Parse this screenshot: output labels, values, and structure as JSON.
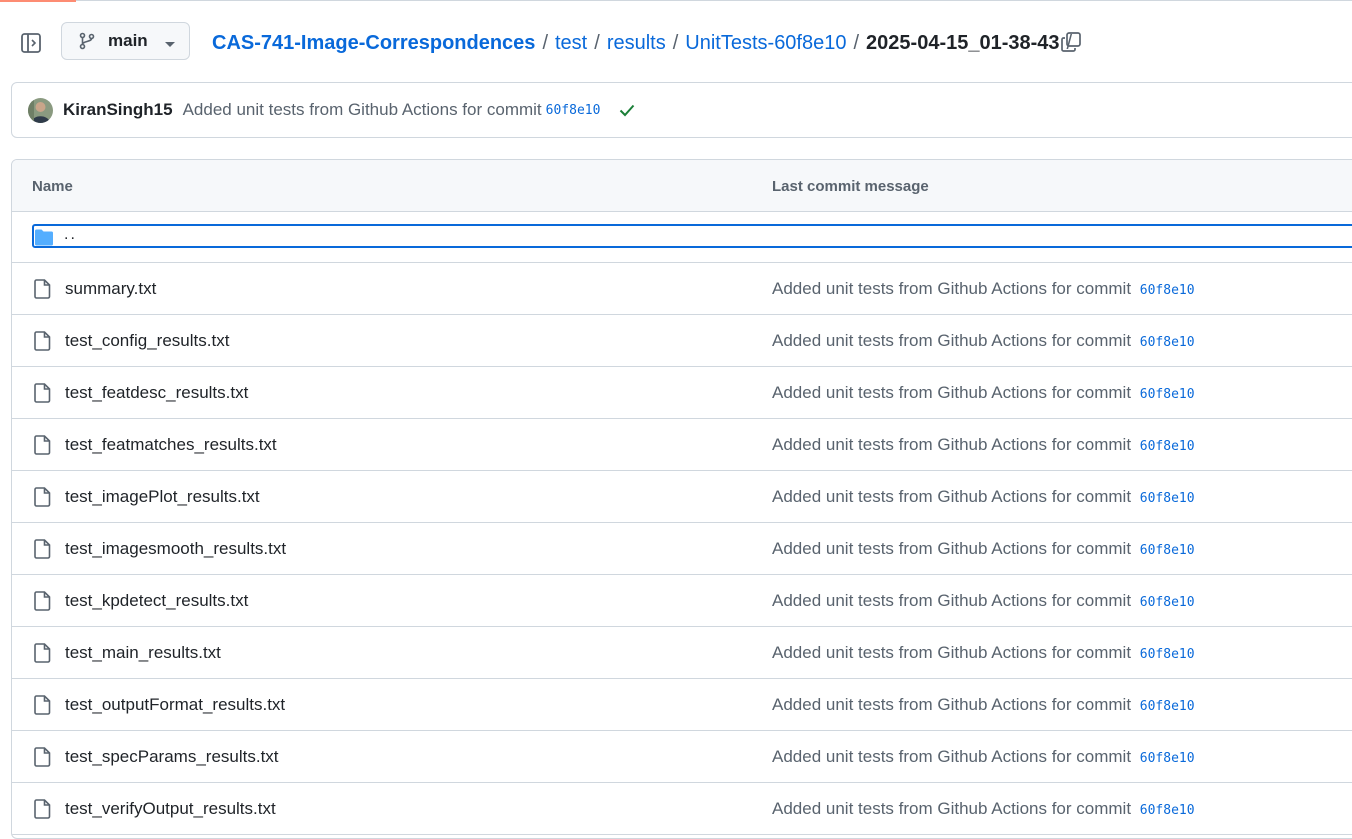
{
  "header": {
    "branch": "main",
    "breadcrumb": [
      {
        "label": "CAS-741-Image-Correspondences",
        "link": true
      },
      {
        "label": "test",
        "link": true
      },
      {
        "label": "results",
        "link": true
      },
      {
        "label": "UnitTests-60f8e10",
        "link": true
      },
      {
        "label": "2025-04-15_01-38-43",
        "link": false
      }
    ],
    "trailing_sep": "/"
  },
  "commit": {
    "author": "KiranSingh15",
    "message": "Added unit tests from Github Actions for commit",
    "sha": "60f8e10",
    "status": "success"
  },
  "table": {
    "col_name": "Name",
    "col_message": "Last commit message",
    "parent_label": "..",
    "rows": [
      {
        "name": "summary.txt",
        "message": "Added unit tests from Github Actions for commit",
        "sha": "60f8e10"
      },
      {
        "name": "test_config_results.txt",
        "message": "Added unit tests from Github Actions for commit",
        "sha": "60f8e10"
      },
      {
        "name": "test_featdesc_results.txt",
        "message": "Added unit tests from Github Actions for commit",
        "sha": "60f8e10"
      },
      {
        "name": "test_featmatches_results.txt",
        "message": "Added unit tests from Github Actions for commit",
        "sha": "60f8e10"
      },
      {
        "name": "test_imagePlot_results.txt",
        "message": "Added unit tests from Github Actions for commit",
        "sha": "60f8e10"
      },
      {
        "name": "test_imagesmooth_results.txt",
        "message": "Added unit tests from Github Actions for commit",
        "sha": "60f8e10"
      },
      {
        "name": "test_kpdetect_results.txt",
        "message": "Added unit tests from Github Actions for commit",
        "sha": "60f8e10"
      },
      {
        "name": "test_main_results.txt",
        "message": "Added unit tests from Github Actions for commit",
        "sha": "60f8e10"
      },
      {
        "name": "test_outputFormat_results.txt",
        "message": "Added unit tests from Github Actions for commit",
        "sha": "60f8e10"
      },
      {
        "name": "test_specParams_results.txt",
        "message": "Added unit tests from Github Actions for commit",
        "sha": "60f8e10"
      },
      {
        "name": "test_verifyOutput_results.txt",
        "message": "Added unit tests from Github Actions for commit",
        "sha": "60f8e10"
      }
    ]
  },
  "colors": {
    "link": "#0969da",
    "muted": "#59636e",
    "border": "#d0d7de",
    "success": "#1a7f37",
    "folder": "#54aeff",
    "accent": "#fd8c73"
  },
  "icons": [
    "sidebar-toggle-icon",
    "git-branch-icon",
    "caret-down-icon",
    "copy-icon",
    "check-icon",
    "folder-icon",
    "file-icon"
  ]
}
